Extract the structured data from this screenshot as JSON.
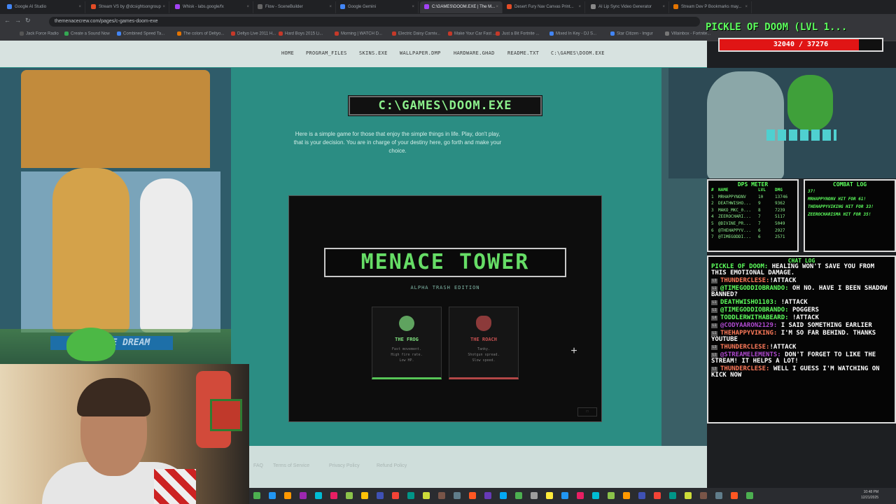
{
  "browser": {
    "tabs": [
      {
        "label": "Google AI Studio",
        "color": "#4285f4"
      },
      {
        "label": "Stream VS by @dcsightsongroup",
        "color": "#e34c26"
      },
      {
        "label": "Whisk - labs.google/fx",
        "color": "#a142f4"
      },
      {
        "label": "Flow - SceneBuilder",
        "color": "#666666"
      },
      {
        "label": "Google Gemini",
        "color": "#4285f4"
      },
      {
        "label": "C:\\GAMES\\DOOM.EXE | The M...",
        "color": "#a142f4"
      },
      {
        "label": "Desert Fury Nav Canvas Print...",
        "color": "#e34c26"
      },
      {
        "label": "AI Lip Sync Video Generator",
        "color": "#888888"
      },
      {
        "label": "Stream Dev P Bookmarks may...",
        "color": "#e37400"
      }
    ],
    "url": "themenacecrew.com/pages/c-games-doom-exe",
    "bookmarks": [
      "Jack Force Radio",
      "Create a Sound Now",
      "Combined Speed Ta...",
      "The colors of Deltyo...",
      "Deltyo Live 2011 H...",
      "Hard Boys 2015 Li...",
      "Morning | WATCH D...",
      "Electric Daisy Carniv...",
      "Make Your Car Fast ...",
      "Just a Bit Fortnite ...",
      "Mixed In Key - DJ S...",
      "Star Citizen - Imgur",
      "Villainbox - Fortnite..."
    ]
  },
  "site": {
    "nav": [
      "HOME",
      "PROGRAM_FILES",
      "SKINS.EXE",
      "WALLPAPER.DMP",
      "HARDWARE.GHAD",
      "README.TXT",
      "C:\\GAMES\\DOOM.EXE"
    ],
    "page_title": "C:\\GAMES\\DOOM.EXE",
    "intro": "Here is a simple game for those that enjoy the simple things in life. Play, don't play, that is your decision. You are in charge of your destiny here, go forth and make your choice.",
    "left_banner": "KEEP THE DREAM",
    "footer": [
      "FAQ",
      "Terms of Service",
      "Privacy Policy",
      "Refund Policy"
    ]
  },
  "game": {
    "title": "MENACE TOWER",
    "subtitle": "ALPHA TRASH EDITION",
    "characters": [
      {
        "name": "THE FROG",
        "desc": "Fast movement.\nHigh fire rate.\nLow HP.",
        "color": "#57c557"
      },
      {
        "name": "THE ROACH",
        "desc": "Tanky.\nShotgun spread.\nSlow speed.",
        "color": "#b34747"
      }
    ]
  },
  "overlay": {
    "boss_title": "PICKLE OF DOOM (LVL 1...",
    "hp_current": 32040,
    "hp_max": 37276,
    "hp_text": "32040 / 37276",
    "dps_title": "DPS METER",
    "dps_headers": [
      "#",
      "NAME",
      "LVL",
      "DMG"
    ],
    "dps_rows": [
      {
        "rank": "1",
        "name": "MRHAPPYNONV",
        "lvl": "10",
        "dmg": "13746"
      },
      {
        "rank": "2",
        "name": "DEATHWISHO...",
        "lvl": "9",
        "dmg": "9362"
      },
      {
        "rank": "3",
        "name": "MAKO_MKC_0...",
        "lvl": "8",
        "dmg": "7239"
      },
      {
        "rank": "4",
        "name": "ZEEROCHARI...",
        "lvl": "7",
        "dmg": "5117"
      },
      {
        "rank": "5",
        "name": "@DIVINE_PR...",
        "lvl": "7",
        "dmg": "5049"
      },
      {
        "rank": "6",
        "name": "@THEHAPPYV...",
        "lvl": "6",
        "dmg": "2927"
      },
      {
        "rank": "7",
        "name": "@TIMEGODDI...",
        "lvl": "6",
        "dmg": "2571"
      }
    ],
    "combat_title": "COMBAT LOG",
    "combat_lines": [
      "37!",
      "MRHAPPYNONV HIT FOR 61!",
      "THEHAPPYVIKING HIT FOR 33!",
      "ZEEROCHARISMA HIT FOR 35!"
    ],
    "chat_title": "CHAT LOG",
    "chat": [
      {
        "lvl": "",
        "user": "PICKLE OF DOOM:",
        "text": " HEALING WON'T SAVE YOU FROM THIS EMOTIONAL DAMAGE.",
        "color": "#5dff5d"
      },
      {
        "lvl": "L3",
        "user": "THUNDERCLESE:",
        "text": "!ATTACK",
        "color": "#ff7a5a"
      },
      {
        "lvl": "L1",
        "user": "@TIMEGODDIOBRANDO:",
        "text": " OH NO. HAVE I BEEN SHADOW BANNED?",
        "color": "#5dff5d"
      },
      {
        "lvl": "L1",
        "user": "DEATHWISHO1103:",
        "text": " !ATTACK",
        "color": "#5dff5d"
      },
      {
        "lvl": "L1",
        "user": "@TIMEGODDIOBRANDO:",
        "text": " POGGERS",
        "color": "#5dff5d"
      },
      {
        "lvl": "L4",
        "user": "TODDLERWITHABEARD:",
        "text": " !ATTACK",
        "color": "#5dff5d"
      },
      {
        "lvl": "L1",
        "user": "@CODYAARON2129:",
        "text": " I SAID SOMETHING EARLIER",
        "color": "#b04ad0"
      },
      {
        "lvl": "L1",
        "user": "THEHAPPYVIKING:",
        "text": " I'M SO FAR BEHIND. THANKS YOUTUBE",
        "color": "#ff7a5a"
      },
      {
        "lvl": "L3",
        "user": "THUNDERCLESE:",
        "text": "!ATTACK",
        "color": "#ff7a5a"
      },
      {
        "lvl": "L1",
        "user": "@STREAMELEMENTS:",
        "text": " DON'T FORGET TO LIKE THE STREAM! IT HELPS A LOT!",
        "color": "#b04ad0"
      },
      {
        "lvl": "L3",
        "user": "THUNDERCLESE:",
        "text": " WELL I GUESS I'M WATCHING ON KICK NOW",
        "color": "#ff7a5a"
      }
    ]
  },
  "taskbar": {
    "time": "10:48 PM",
    "date": "12/21/2025",
    "icon_colors": [
      "#4caf50",
      "#2196f3",
      "#ff9800",
      "#9c27b0",
      "#00bcd4",
      "#e91e63",
      "#8bc34a",
      "#ffc107",
      "#3f51b5",
      "#f44336",
      "#009688",
      "#cddc39",
      "#795548",
      "#607d8b",
      "#ff5722",
      "#673ab7",
      "#03a9f4",
      "#4caf50",
      "#9e9e9e",
      "#ffeb3b",
      "#2196f3",
      "#e91e63",
      "#00bcd4",
      "#8bc34a",
      "#ff9800",
      "#3f51b5",
      "#f44336",
      "#009688",
      "#cddc39",
      "#795548",
      "#607d8b",
      "#ff5722",
      "#4caf50"
    ]
  }
}
